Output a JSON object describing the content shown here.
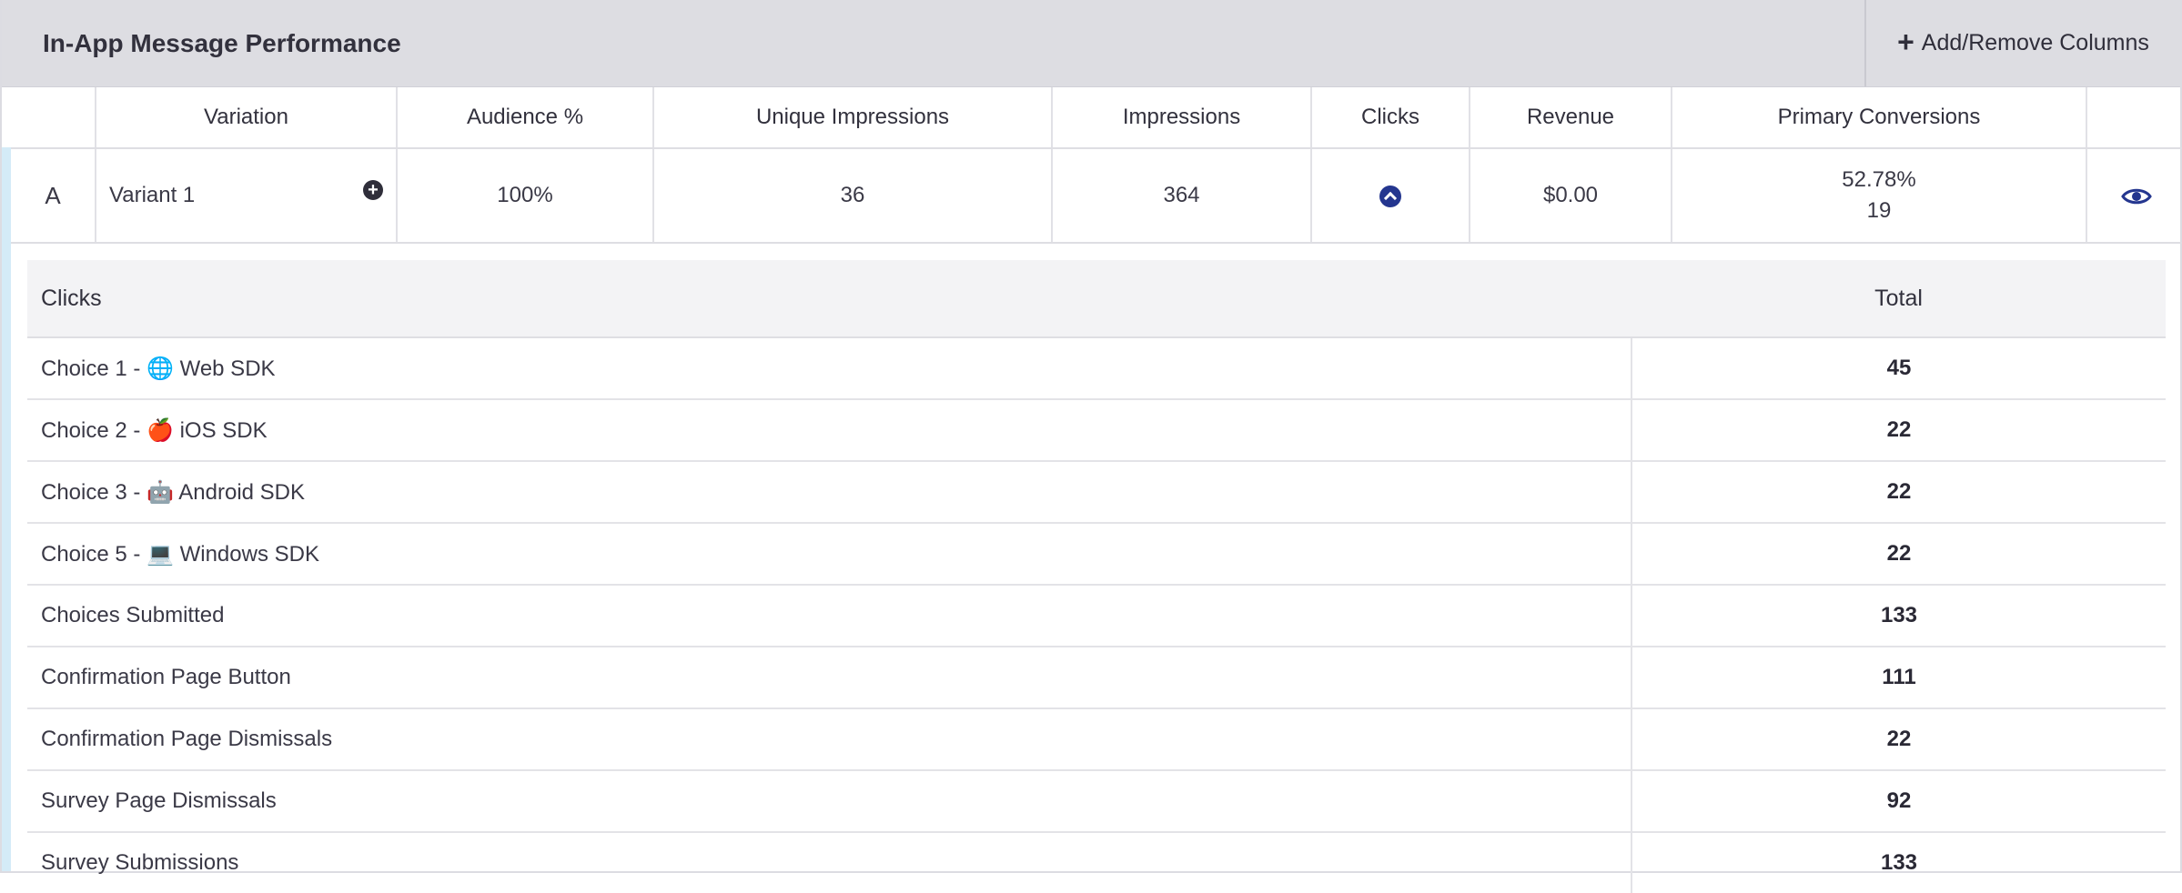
{
  "header": {
    "title": "In-App Message Performance",
    "add_columns_label": "Add/Remove Columns"
  },
  "columns": [
    "",
    "Variation",
    "Audience %",
    "Unique Impressions",
    "Impressions",
    "Clicks",
    "Revenue",
    "Primary Conversions",
    ""
  ],
  "variant_row": {
    "letter": "A",
    "name": "Variant 1",
    "audience": "100%",
    "unique_impressions": "36",
    "impressions": "364",
    "revenue": "$0.00",
    "conversion_rate": "52.78%",
    "conversion_count": "19"
  },
  "clicks_table": {
    "header_label": "Clicks",
    "header_total": "Total",
    "rows": [
      {
        "label": "Choice 1 - 🌐 Web SDK",
        "total": "45"
      },
      {
        "label": "Choice 2 - 🍎 iOS SDK",
        "total": "22"
      },
      {
        "label": "Choice 3 - 🤖 Android SDK",
        "total": "22"
      },
      {
        "label": "Choice 5 - 💻 Windows SDK",
        "total": "22"
      },
      {
        "label": "Choices Submitted",
        "total": "133"
      },
      {
        "label": "Confirmation Page Button",
        "total": "111"
      },
      {
        "label": "Confirmation Page Dismissals",
        "total": "22"
      },
      {
        "label": "Survey Page Dismissals",
        "total": "92"
      },
      {
        "label": "Survey Submissions",
        "total": "133"
      }
    ]
  },
  "icons": {
    "add": "plus-icon",
    "expand": "circle-plus-icon",
    "clicks_toggle": "chevron-up-icon",
    "preview": "eye-icon"
  },
  "colors": {
    "accent": "#24368f",
    "row_highlight": "#d4ebf7",
    "header_bg": "#dddde2"
  }
}
